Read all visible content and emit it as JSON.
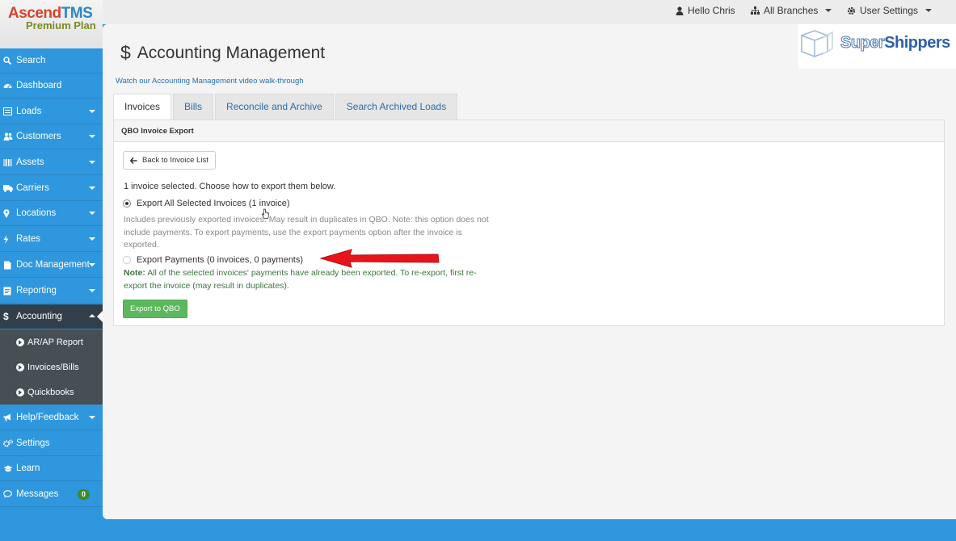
{
  "brand": {
    "name_a": "Ascend",
    "name_b": "TMS",
    "plan": "Premium Plan"
  },
  "topnav": {
    "user": "Hello Chris",
    "branches": "All Branches",
    "settings": "User Settings"
  },
  "sidebar": {
    "items": [
      {
        "label": "Search",
        "icon": "search-icon"
      },
      {
        "label": "Dashboard",
        "icon": "dashboard-icon"
      },
      {
        "label": "Loads",
        "icon": "list-icon"
      },
      {
        "label": "Customers",
        "icon": "users-icon"
      },
      {
        "label": "Assets",
        "icon": "barcode-icon"
      },
      {
        "label": "Carriers",
        "icon": "truck-icon"
      },
      {
        "label": "Locations",
        "icon": "map-marker-icon"
      },
      {
        "label": "Rates",
        "icon": "bolt-icon"
      },
      {
        "label": "Doc Management",
        "icon": "file-icon"
      },
      {
        "label": "Reporting",
        "icon": "report-icon"
      },
      {
        "label": "Accounting",
        "icon": "dollar-icon"
      }
    ],
    "sub_items": [
      {
        "label": "AR/AP Report"
      },
      {
        "label": "Invoices/Bills"
      },
      {
        "label": "Quickbooks"
      }
    ],
    "bottom_items": [
      {
        "label": "Help/Feedback",
        "icon": "bullhorn-icon"
      },
      {
        "label": "Settings",
        "icon": "cogs-icon"
      },
      {
        "label": "Learn",
        "icon": "graduation-cap-icon"
      },
      {
        "label": "Messages",
        "icon": "comment-icon",
        "badge": "0"
      }
    ]
  },
  "page": {
    "title": "Accounting Management",
    "video_link": "Watch our Accounting Management video walk-through",
    "partner_logo_a": "Super",
    "partner_logo_b": "Shippers"
  },
  "tabs": [
    {
      "label": "Invoices",
      "active": true
    },
    {
      "label": "Bills",
      "active": false
    },
    {
      "label": "Reconcile and Archive",
      "active": false
    },
    {
      "label": "Search Archived Loads",
      "active": false
    }
  ],
  "panel": {
    "heading": "QBO Invoice Export",
    "back_button": "Back to Invoice List",
    "intro": "1 invoice selected. Choose how to export them below.",
    "option1_label": "Export All Selected Invoices (1 invoice)",
    "option1_help": "Includes previously exported invoices. May result in duplicates in QBO. Note: this option does not include payments. To export payments, use the export payments option after the invoice is exported.",
    "option2_label": "Export Payments (0 invoices, 0 payments)",
    "note_label": "Note:",
    "note_text": "All of the selected invoices' payments have already been exported. To re-export, first re-export the invoice (may result in duplicates).",
    "export_button": "Export to QBO"
  },
  "colors": {
    "sidebar": "#2f97dd",
    "active": "#313f4a",
    "submenu": "#474f55",
    "success": "#5cb85c",
    "arrow": "#e8141a"
  }
}
